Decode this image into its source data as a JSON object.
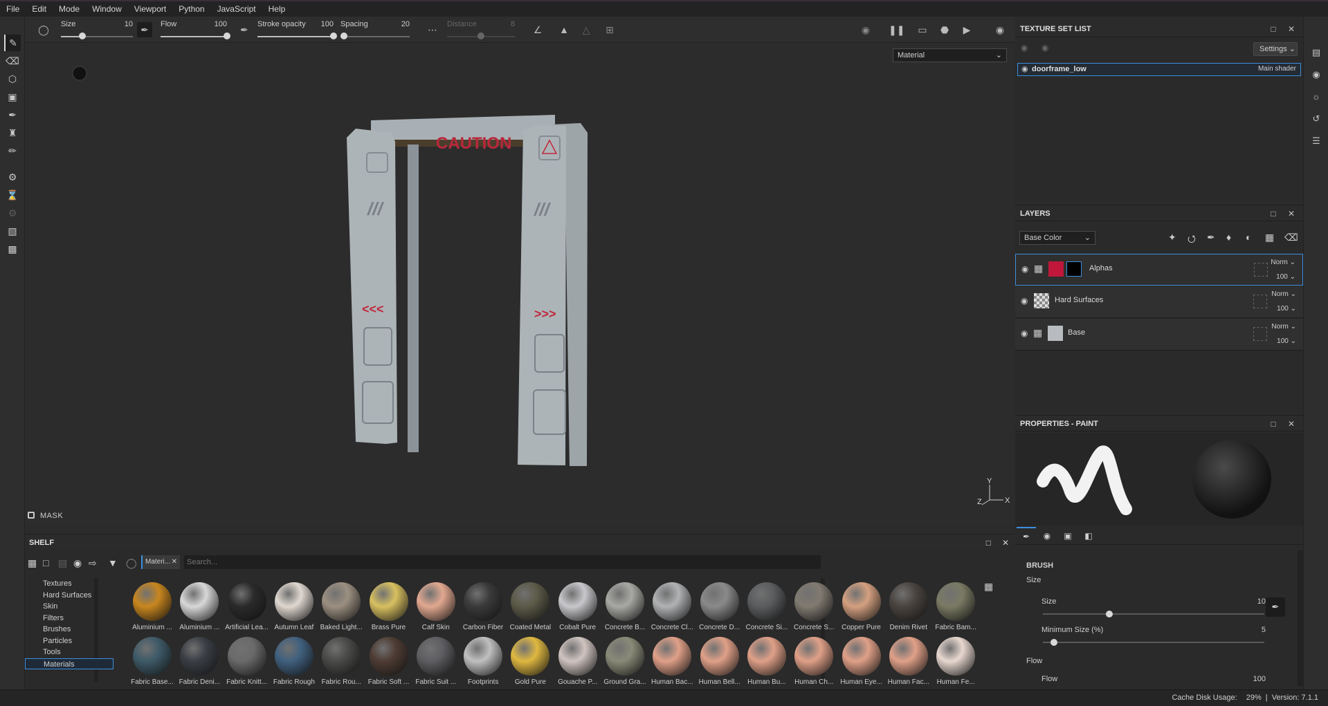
{
  "menu": [
    "File",
    "Edit",
    "Mode",
    "Window",
    "Viewport",
    "Python",
    "JavaScript",
    "Help"
  ],
  "toolbar": {
    "size": {
      "label": "Size",
      "value": "10",
      "fraction": 0.3
    },
    "flow": {
      "label": "Flow",
      "value": "100",
      "fraction": 1.0
    },
    "stroke_opacity": {
      "label": "Stroke opacity",
      "value": "100",
      "fraction": 1.0
    },
    "spacing": {
      "label": "Spacing",
      "value": "20",
      "fraction": 0.05
    },
    "distance": {
      "label": "Distance",
      "value": "8",
      "fraction": 0.5
    }
  },
  "viewport": {
    "material_select": "Material",
    "mask_label": "MASK",
    "model_text": "CAUTION",
    "axes": {
      "y": "Y",
      "z": "Z",
      "x": "X"
    }
  },
  "texture_set_list": {
    "title": "TEXTURE SET LIST",
    "settings_label": "Settings",
    "item_name": "doorframe_low",
    "item_shader": "Main shader"
  },
  "layers": {
    "title": "LAYERS",
    "channel_select": "Base Color",
    "rows": [
      {
        "name": "Alphas",
        "blend": "Norm",
        "opacity": "100",
        "color": "#c0173a"
      },
      {
        "name": "Hard Surfaces",
        "blend": "Norm",
        "opacity": "100",
        "color": "#cccccc"
      },
      {
        "name": "Base",
        "blend": "Norm",
        "opacity": "100",
        "color": "#b8bcc0"
      }
    ]
  },
  "properties": {
    "title": "PROPERTIES - PAINT",
    "brush_title": "BRUSH",
    "size_section": "Size",
    "size_label": "Size",
    "size_value": "10",
    "min_size_label": "Minimum Size (%)",
    "min_size_value": "5",
    "flow_section": "Flow",
    "flow_label": "Flow",
    "flow_value": "100"
  },
  "shelf": {
    "title": "SHELF",
    "filter_tag": "Materi...",
    "search_placeholder": "Search...",
    "categories": [
      "Textures",
      "Hard Surfaces",
      "Skin",
      "Filters",
      "Brushes",
      "Particles",
      "Tools",
      "Materials"
    ],
    "materials_row1": [
      {
        "name": "Aluminium ...",
        "color": "#c8861e"
      },
      {
        "name": "Aluminium ...",
        "color": "#d8d8d8"
      },
      {
        "name": "Artificial Lea...",
        "color": "#2a2a2a"
      },
      {
        "name": "Autumn Leaf",
        "color": "#e0d8d0"
      },
      {
        "name": "Baked Light...",
        "color": "#9b8f80"
      },
      {
        "name": "Brass Pure",
        "color": "#d8c060"
      },
      {
        "name": "Calf Skin",
        "color": "#e2a890"
      },
      {
        "name": "Carbon Fiber",
        "color": "#3a3a3a"
      },
      {
        "name": "Coated Metal",
        "color": "#5c5a48"
      },
      {
        "name": "Cobalt Pure",
        "color": "#c8c8cc"
      },
      {
        "name": "Concrete B...",
        "color": "#a8a8a4"
      },
      {
        "name": "Concrete Cl...",
        "color": "#b0b2b4"
      },
      {
        "name": "Concrete D...",
        "color": "#8a8a8a"
      },
      {
        "name": "Concrete Si...",
        "color": "#5a5c5e"
      },
      {
        "name": "Concrete S...",
        "color": "#807a70"
      },
      {
        "name": "Copper Pure",
        "color": "#d4a080"
      },
      {
        "name": "Denim Rivet",
        "color": "#4a4440"
      },
      {
        "name": "Fabric Bam...",
        "color": "#7a7a64"
      }
    ],
    "materials_row2": [
      {
        "name": "Fabric Base...",
        "color": "#3e5a68"
      },
      {
        "name": "Fabric Deni...",
        "color": "#3a3e44"
      },
      {
        "name": "Fabric Knitt...",
        "color": "#6a6a6a"
      },
      {
        "name": "Fabric Rough",
        "color": "#40607e"
      },
      {
        "name": "Fabric Rou...",
        "color": "#4a4a48"
      },
      {
        "name": "Fabric Soft ...",
        "color": "#4e3c34"
      },
      {
        "name": "Fabric Suit ...",
        "color": "#5e5e62"
      },
      {
        "name": "Footprints",
        "color": "#c0c0c0"
      },
      {
        "name": "Gold Pure",
        "color": "#e0b840"
      },
      {
        "name": "Gouache P...",
        "color": "#d0c4c0"
      },
      {
        "name": "Ground Gra...",
        "color": "#8a8a78"
      },
      {
        "name": "Human Bac...",
        "color": "#e0a088"
      },
      {
        "name": "Human Bell...",
        "color": "#e0a088"
      },
      {
        "name": "Human Bu...",
        "color": "#e0a088"
      },
      {
        "name": "Human Ch...",
        "color": "#e0a088"
      },
      {
        "name": "Human Eye...",
        "color": "#e0a088"
      },
      {
        "name": "Human Fac...",
        "color": "#e0a088"
      },
      {
        "name": "Human Fe...",
        "color": "#e8d8d0"
      }
    ]
  },
  "status": {
    "cache_label": "Cache Disk Usage:",
    "cache_value": "29%",
    "version": "Version: 7.1.1"
  }
}
